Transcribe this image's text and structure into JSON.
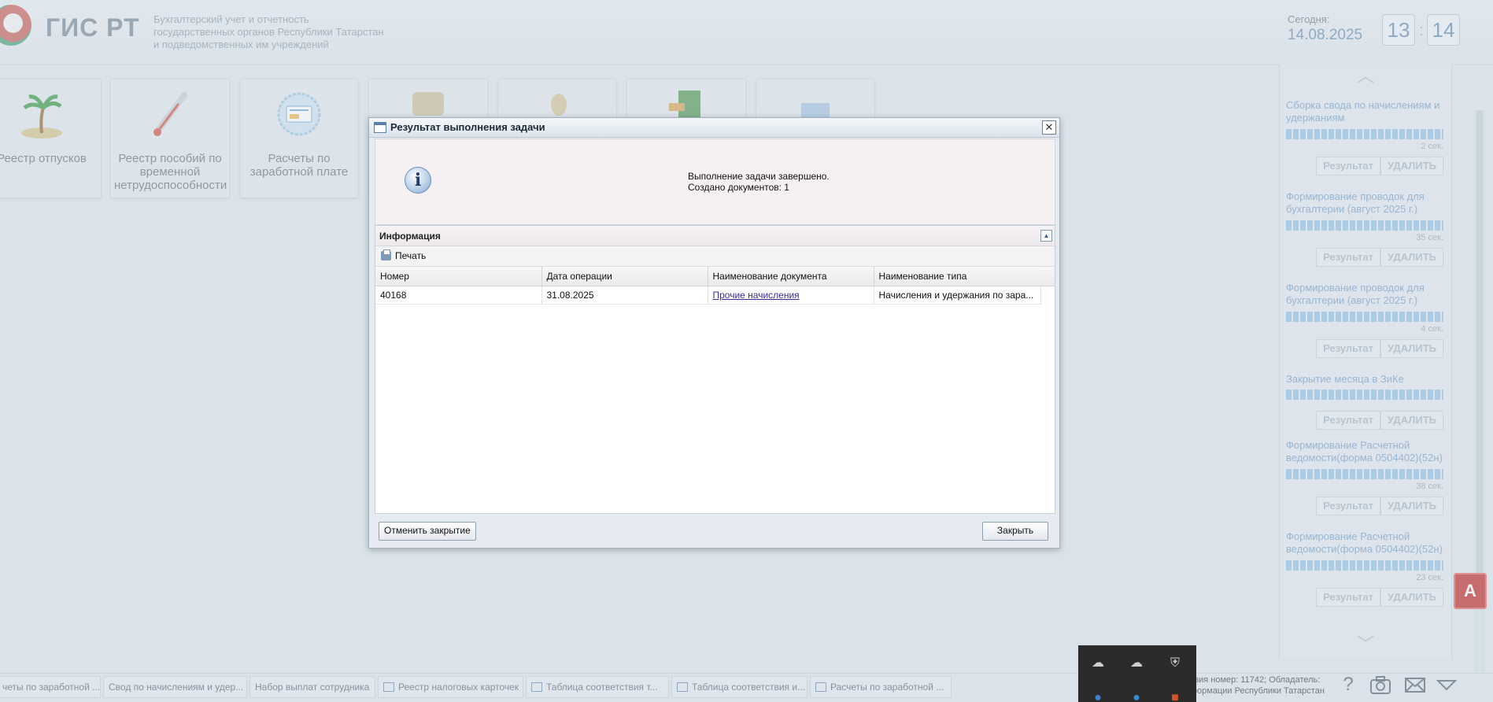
{
  "header": {
    "logo_text": "ГИС РТ",
    "subtitle_lines": [
      "Бухгалтерский учет и отчетность",
      "государственных органов Республики Татарстан",
      "и подведомственных им учреждений"
    ],
    "today_label": "Сегодня:",
    "today_date": "14.08.2025",
    "clock_hours": "13",
    "clock_minutes": "14",
    "clock_separator": ":"
  },
  "tiles": [
    {
      "label": "Реестр отпусков",
      "icon": "palm-island-icon"
    },
    {
      "label": "Реестр пособий по временной нетрудоспособности",
      "icon": "thermometer-icon"
    },
    {
      "label": "Расчеты по заработной плате",
      "icon": "payment-badge-icon"
    },
    {
      "label": "",
      "icon": "scroll-icon"
    },
    {
      "label": "",
      "icon": "hand-icon"
    },
    {
      "label": "",
      "icon": "book-icon"
    },
    {
      "label": "",
      "icon": "building-icon"
    }
  ],
  "dialog": {
    "title": "Результат выполнения задачи",
    "message_line1": "Выполнение задачи завершено.",
    "message_line2": "Создано документов: 1",
    "info_header": "Информация",
    "print_label": "Печать",
    "columns": [
      "Номер",
      "Дата операции",
      "Наименование документа",
      "Наименование типа"
    ],
    "rows": [
      {
        "number": "40168",
        "date": "31.08.2025",
        "doc_name": "Прочие начисления",
        "type_name": "Начисления и удержания по зара..."
      }
    ],
    "cancel_close_label": "Отменить закрытие",
    "close_label": "Закрыть"
  },
  "tasks": {
    "result_label": "Результат",
    "delete_label": "УДАЛИТЬ",
    "items": [
      {
        "title": "Сборка свода по начислениям и удержаниям",
        "time": "2 сек."
      },
      {
        "title": "Формирование проводок для бухгалтерии (август 2025 г.)",
        "time": "35 сек."
      },
      {
        "title": "Формирование проводок для бухгалтерии (август 2025 г.)",
        "time": "4 сек."
      },
      {
        "title": "Закрытие месяца в ЗиКе",
        "time": ""
      },
      {
        "title": "Формирование Расчетной ведомости(форма 0504402)(52н)",
        "time": "38 сек."
      },
      {
        "title": "Формирование Расчетной ведомости(форма 0504402)(52н)",
        "time": "23 сек."
      }
    ]
  },
  "taskbar": {
    "items": [
      "четы по заработной ...",
      "Свод по начислениям и удер...",
      "Набор выплат сотрудника",
      "Реестр налоговых карточек",
      "Таблица соответствия т...",
      "Таблица соответствия и...",
      "Расчеты по заработной ..."
    ],
    "license_line1": "нзия номер: 11742; Обладатель:",
    "license_line2": "формации Республики Татарстан"
  },
  "colors": {
    "accent_blue": "#6c8fb4",
    "link": "#3a2d9a",
    "pdf_red": "#c2302e"
  }
}
